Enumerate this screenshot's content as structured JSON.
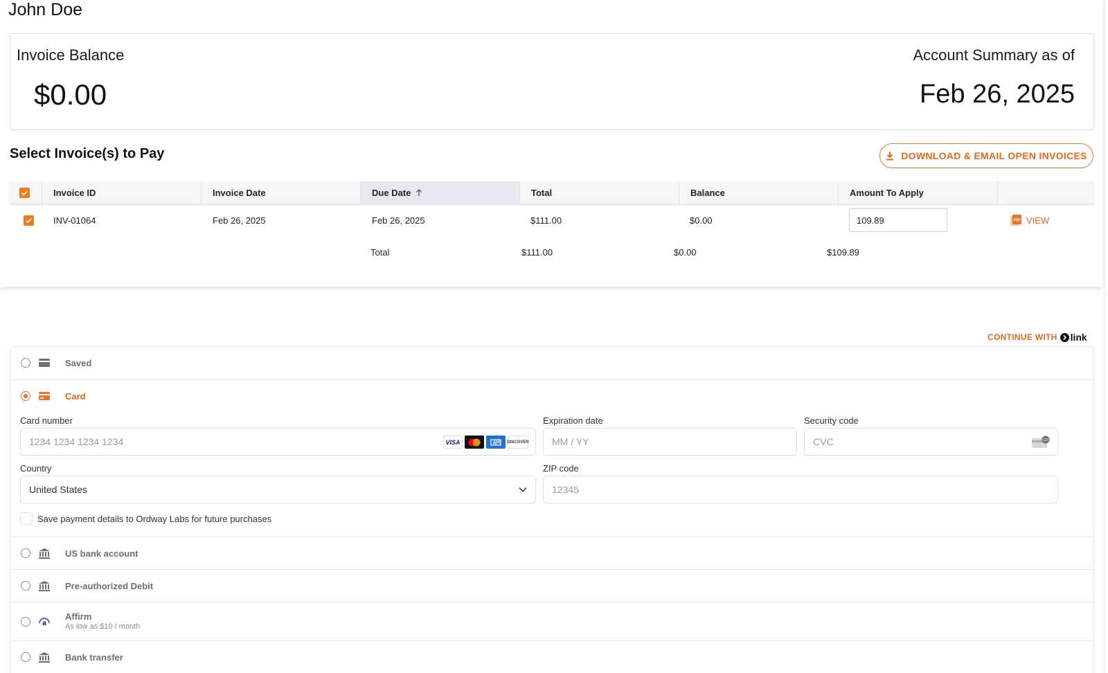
{
  "customer": {
    "name": "John Doe"
  },
  "balance_card": {
    "balance_label": "Invoice Balance",
    "balance_amount": "$0.00",
    "summary_label": "Account Summary as of",
    "summary_date": "Feb 26, 2025"
  },
  "invoices": {
    "title": "Select Invoice(s) to Pay",
    "download_label": "DOWNLOAD & EMAIL OPEN INVOICES",
    "columns": [
      "Invoice ID",
      "Invoice Date",
      "Due Date",
      "Total",
      "Balance",
      "Amount To Apply"
    ],
    "sorted_column": "Due Date",
    "rows": [
      {
        "invoice_id": "INV-01064",
        "invoice_date": "Feb 26, 2025",
        "due_date": "Feb 26, 2025",
        "total": "$111.00",
        "balance": "$0.00",
        "amount_to_apply": "109.89",
        "checked": true,
        "view_label": "VIEW"
      }
    ],
    "totals": {
      "label": "Total",
      "total": "$111.00",
      "balance": "$0.00",
      "amount": "$109.89"
    }
  },
  "payment": {
    "link_prefix": "CONTINUE WITH",
    "link_brand": "link",
    "methods": {
      "saved": "Saved",
      "card": "Card",
      "us_bank": "US bank account",
      "preauth": "Pre-authorized Debit",
      "affirm": "Affirm",
      "affirm_sub": "As low as $10 / month",
      "bank_transfer": "Bank transfer"
    },
    "selected_method": "Card",
    "card_form": {
      "card_number_label": "Card number",
      "card_number_placeholder": "1234 1234 1234 1234",
      "expiry_label": "Expiration date",
      "expiry_placeholder": "MM / YY",
      "cvc_label": "Security code",
      "cvc_placeholder": "CVC",
      "country_label": "Country",
      "country_value": "United States",
      "zip_label": "ZIP code",
      "zip_placeholder": "12345",
      "save_label": "Save payment details to Ordway Labs for future purchases",
      "brands": [
        "VISA",
        "DISCOVER"
      ]
    }
  },
  "colors": {
    "accent": "#e8752a",
    "accent_text": "#e06a1b",
    "muted": "#6d6e78"
  }
}
